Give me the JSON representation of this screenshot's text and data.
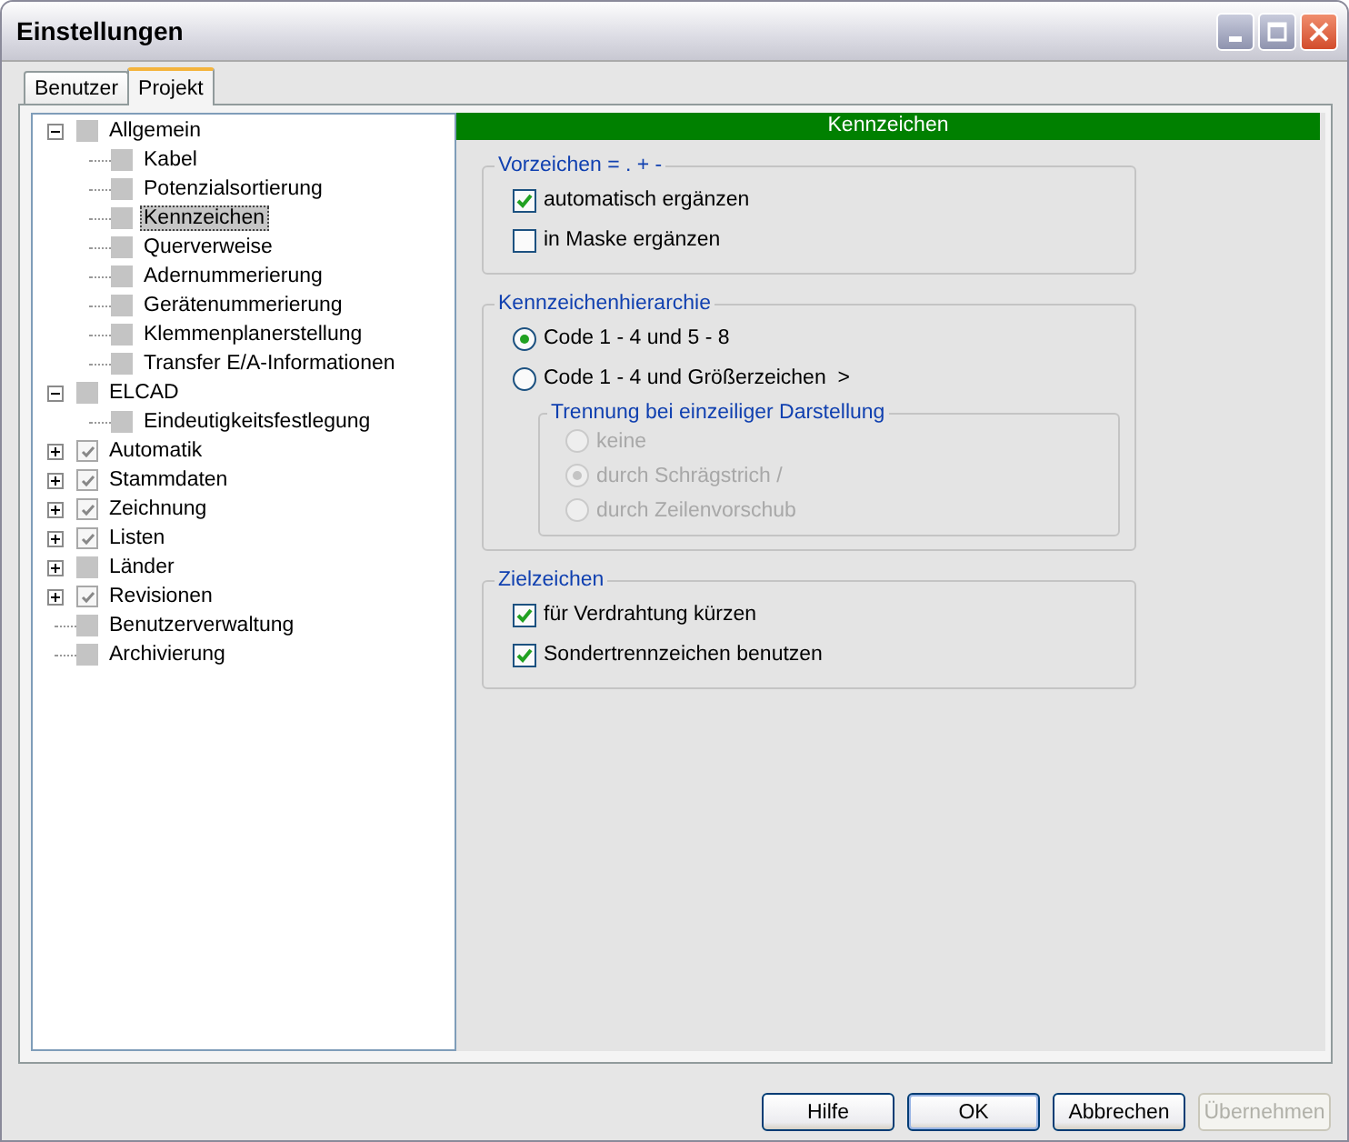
{
  "window": {
    "title": "Einstellungen"
  },
  "tabs": [
    {
      "label": "Benutzer",
      "selected": false
    },
    {
      "label": "Projekt",
      "selected": true
    }
  ],
  "tree": [
    {
      "label": "Allgemein",
      "checked": false,
      "expanded": true,
      "selected": false,
      "children": [
        {
          "label": "Kabel",
          "checked": false,
          "selected": false
        },
        {
          "label": "Potenzialsortierung",
          "checked": false,
          "selected": false
        },
        {
          "label": "Kennzeichen",
          "checked": false,
          "selected": true
        },
        {
          "label": "Querverweise",
          "checked": false,
          "selected": false
        },
        {
          "label": "Adernummerierung",
          "checked": false,
          "selected": false
        },
        {
          "label": "Gerätenummerierung",
          "checked": false,
          "selected": false
        },
        {
          "label": "Klemmenplanerstellung",
          "checked": false,
          "selected": false
        },
        {
          "label": "Transfer E/A-Informationen",
          "checked": false,
          "selected": false
        }
      ]
    },
    {
      "label": "ELCAD",
      "checked": false,
      "expanded": true,
      "selected": false,
      "children": [
        {
          "label": "Eindeutigkeitsfestlegung",
          "checked": false,
          "selected": false
        }
      ]
    },
    {
      "label": "Automatik",
      "checked": true,
      "expanded": false,
      "selected": false
    },
    {
      "label": "Stammdaten",
      "checked": true,
      "expanded": false,
      "selected": false
    },
    {
      "label": "Zeichnung",
      "checked": true,
      "expanded": false,
      "selected": false
    },
    {
      "label": "Listen",
      "checked": true,
      "expanded": false,
      "selected": false
    },
    {
      "label": "Länder",
      "checked": false,
      "expanded": false,
      "selected": false
    },
    {
      "label": "Revisionen",
      "checked": true,
      "expanded": false,
      "selected": false
    },
    {
      "label": "Benutzerverwaltung",
      "checked": false,
      "selected": false
    },
    {
      "label": "Archivierung",
      "checked": false,
      "selected": false
    }
  ],
  "panel": {
    "title": "Kennzeichen",
    "groups": [
      {
        "title": "Vorzeichen = . + -",
        "items": [
          {
            "kind": "checkbox",
            "label": "automatisch ergänzen",
            "checked": true,
            "disabled": false
          },
          {
            "kind": "checkbox",
            "label": "in Maske ergänzen",
            "checked": false,
            "disabled": false
          }
        ]
      },
      {
        "title": "Kennzeichenhierarchie",
        "items": [
          {
            "kind": "radio",
            "label": "Code 1 - 4 und 5 - 8",
            "selected": true,
            "disabled": false
          },
          {
            "kind": "radio",
            "label": "Code 1 - 4 und Größerzeichen  >",
            "selected": false,
            "disabled": false
          },
          {
            "kind": "group",
            "title": "Trennung bei einzeiliger Darstellung",
            "items": [
              {
                "kind": "radio",
                "label": "keine",
                "selected": false,
                "disabled": true
              },
              {
                "kind": "radio",
                "label": "durch Schrägstrich /",
                "selected": true,
                "disabled": true
              },
              {
                "kind": "radio",
                "label": "durch Zeilenvorschub",
                "selected": false,
                "disabled": true
              }
            ]
          }
        ]
      },
      {
        "title": "Zielzeichen",
        "items": [
          {
            "kind": "checkbox",
            "label": "für Verdrahtung kürzen",
            "checked": true,
            "disabled": false
          },
          {
            "kind": "checkbox",
            "label": "Sondertrennzeichen benutzen",
            "checked": true,
            "disabled": false
          }
        ]
      }
    ]
  },
  "buttons": [
    {
      "label": "Hilfe",
      "default": false,
      "disabled": false
    },
    {
      "label": "OK",
      "default": true,
      "disabled": false
    },
    {
      "label": "Abbrechen",
      "default": false,
      "disabled": false
    },
    {
      "label": "Übernehmen",
      "default": false,
      "disabled": true
    }
  ]
}
